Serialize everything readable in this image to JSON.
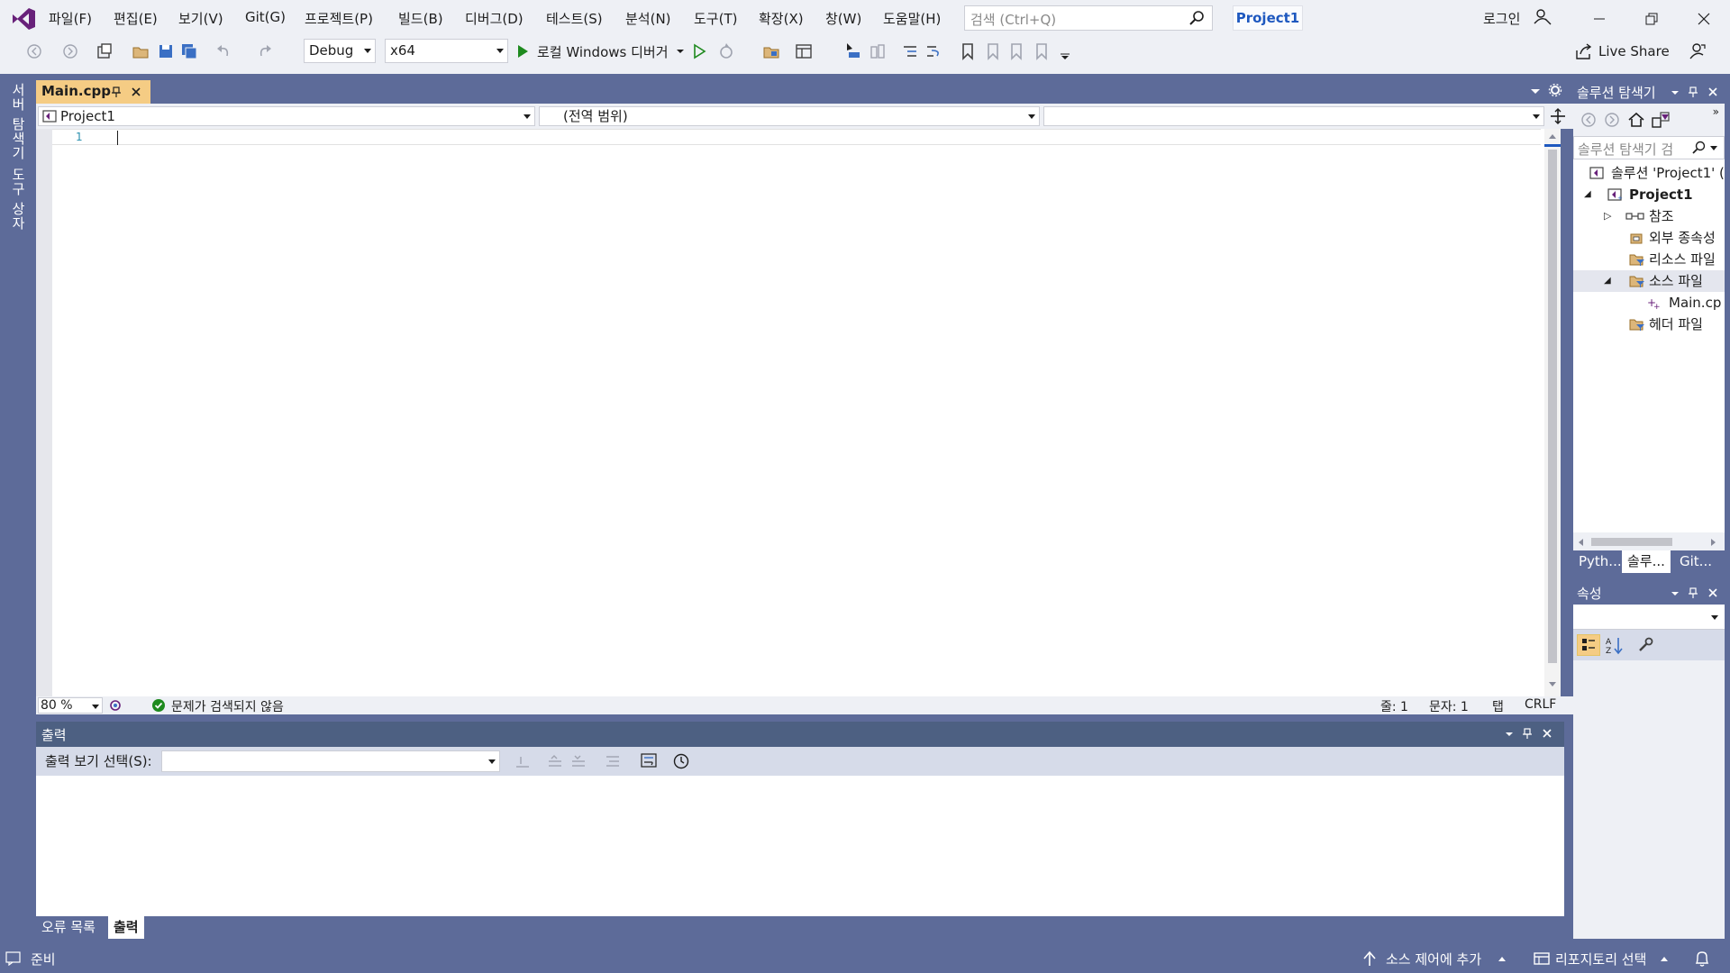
{
  "menu": {
    "items": [
      "파일(F)",
      "편집(E)",
      "보기(V)",
      "Git(G)",
      "프로젝트(P)",
      "빌드(B)",
      "디버그(D)",
      "테스트(S)",
      "분석(N)",
      "도구(T)",
      "확장(X)",
      "창(W)",
      "도움말(H)"
    ]
  },
  "search": {
    "placeholder": "검색 (Ctrl+Q)"
  },
  "project_badge": "Project1",
  "account": {
    "login_label": "로그인"
  },
  "toolbar": {
    "config": "Debug",
    "platform": "x64",
    "run_label": "로컬 Windows 디버거",
    "live_share": "Live Share"
  },
  "side_tabs": {
    "server_explorer": "서버 탐색기",
    "toolbox": "도구 상자"
  },
  "editor": {
    "tab_label": "Main.cpp",
    "nav_project": "Project1",
    "nav_scope": "(전역 범위)",
    "nav_member": "",
    "line_number": "1",
    "zoom": "80 %",
    "issues": "문제가 검색되지 않음",
    "line": "줄: 1",
    "col": "문자: 1",
    "indent": "탭",
    "eol": "CRLF"
  },
  "output": {
    "title": "출력",
    "select_label": "출력 보기 선택(S):",
    "select_value": "",
    "tabs": [
      "오류 목록",
      "출력"
    ],
    "active_tab": 1
  },
  "solution_explorer": {
    "title": "솔루션 탐색기",
    "search_placeholder": "솔루션 탐색기 검",
    "tree": [
      {
        "label": "솔루션 'Project1' (",
        "depth": 0,
        "icon": "solution-icon",
        "expander": ""
      },
      {
        "label": "Project1",
        "depth": 1,
        "icon": "project-icon",
        "expander": "◢",
        "bold": true
      },
      {
        "label": "참조",
        "depth": 2,
        "icon": "references-icon",
        "expander": "▷"
      },
      {
        "label": "외부 종속성",
        "depth": 2,
        "icon": "external-deps-icon",
        "expander": ""
      },
      {
        "label": "리소스 파일",
        "depth": 2,
        "icon": "filter-folder-icon",
        "expander": ""
      },
      {
        "label": "소스 파일",
        "depth": 2,
        "icon": "filter-folder-icon",
        "expander": "◢",
        "selected": true
      },
      {
        "label": "Main.cp",
        "depth": 3,
        "icon": "cpp-file-icon",
        "expander": ""
      },
      {
        "label": "헤더 파일",
        "depth": 2,
        "icon": "filter-folder-icon",
        "expander": ""
      }
    ],
    "tabs": [
      "Pyth...",
      "솔루...",
      "Git..."
    ],
    "active_tab": 1
  },
  "properties": {
    "title": "속성"
  },
  "status": {
    "ready": "준비",
    "source_control": "소스 제어에 추가",
    "repo": "리포지토리 선택"
  },
  "colors": {
    "chrome": "#eef0f5",
    "frame": "#5d6b99",
    "active_tab": "#f5cc84",
    "accent": "#68217a",
    "run_green": "#1e8a1e"
  }
}
